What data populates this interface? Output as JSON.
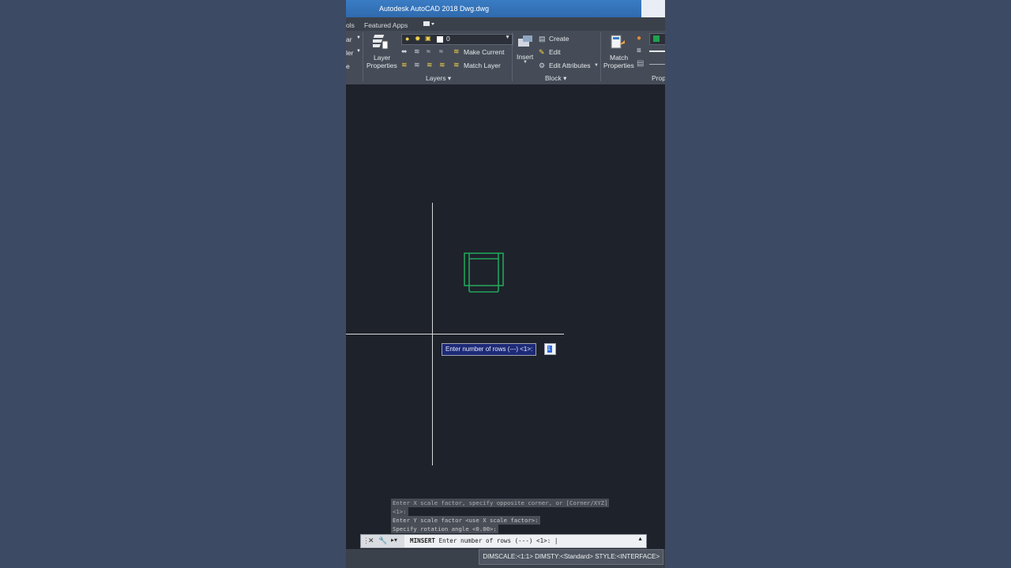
{
  "titlebar": {
    "app": "Autodesk AutoCAD 2018",
    "file": "Dwg.dwg"
  },
  "tabs": {
    "left_fragment": "ols",
    "featured": "Featured Apps"
  },
  "ribbon": {
    "left_fragments": [
      "ar",
      "ler",
      "e"
    ],
    "layers": {
      "properties_line1": "Layer",
      "properties_line2": "Properties",
      "current_layer": "0",
      "make_current": "Make Current",
      "match_layer": "Match Layer",
      "panel_title": "Layers"
    },
    "block": {
      "insert": "Insert",
      "create": "Create",
      "edit": "Edit",
      "edit_attributes": "Edit Attributes",
      "panel_title": "Block"
    },
    "properties": {
      "match_line1": "Match",
      "match_line2": "Properties",
      "panel_title_fragment": "Prop"
    }
  },
  "tooltip": {
    "prompt": "Enter number of rows (---) <1>:",
    "value": "1"
  },
  "history": [
    "Enter X scale factor, specify opposite corner, or [Corner/XYZ]",
    "<1>:",
    "Enter Y scale factor <use X scale factor>:",
    "Specify rotation angle <0.00>:"
  ],
  "command": {
    "name": "MINSERT",
    "prompt": "Enter number of rows (---) <1>:"
  },
  "status": {
    "text": "DIMSCALE:<1:1> DIMSTY:<Standard> STYLE:<INTERFACE>"
  },
  "colors": {
    "accent": "#2f6aae",
    "drawing": "#22a35a",
    "canvas": "#1e222b"
  }
}
